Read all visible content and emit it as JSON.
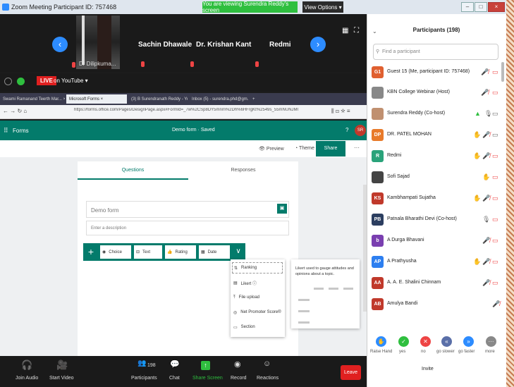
{
  "window": {
    "title": "Zoom Meeting Participant ID: 757468",
    "viewing_banner": "You are viewing Surendra Reddy's screen",
    "view_options": "View Options ▾"
  },
  "strip": {
    "thumb_label": "Dr Dilipkuma...",
    "names": [
      "Sachin Dhawale",
      "Dr. Krishan Kant",
      "Redmi"
    ]
  },
  "live": {
    "badge": "LIVE",
    "platform": "on YouTube ▾"
  },
  "browser": {
    "tabs": [
      "Swami Ramanand Teerth Mar... ×",
      "Microsoft Forms ×",
      "(3) B Surendranath Reddy - Yo... ×",
      "Inbox (5) - surendra.phd@gm... ×",
      "+"
    ],
    "url": "https://forms.office.com/Pages/DesignPage.aspx#FormId=_7w%2CSp8DY5mnm%2Dh%6HFrgKt%2549s_55mNUNJMO"
  },
  "forms": {
    "app_name": "Forms",
    "doc_title": "Demo form · Saved",
    "avatar": "SR",
    "preview": "Preview",
    "theme": "Theme",
    "share": "Share",
    "tab_questions": "Questions",
    "tab_responses": "Responses",
    "title_placeholder": "Demo form",
    "desc_placeholder": "Enter a description",
    "add_types": [
      "Choice",
      "Text",
      "Rating",
      "Date"
    ],
    "more_types": [
      "Ranking",
      "Likert ⓘ",
      "File upload",
      "Net Promoter Score®",
      "Section"
    ],
    "tooltip": "Likert used to gauge attitudes and opinions about a topic."
  },
  "bottom": {
    "join_audio": "Join Audio",
    "start_video": "Start Video",
    "participants_count": "198",
    "participants": "Participants",
    "chat": "Chat",
    "share_screen": "Share Screen",
    "record": "Record",
    "reactions": "Reactions",
    "leave": "Leave"
  },
  "panel": {
    "title": "Participants (198)",
    "search_placeholder": "Find a participant",
    "participants": [
      {
        "initials": "G1",
        "name": "Guest 15 (Me, participant ID: 757468)",
        "color": "#e06030"
      },
      {
        "initials": "",
        "name": "KBN College Webinar (Host)",
        "color": "#888888"
      },
      {
        "initials": "",
        "name": "Surendra Reddy (Co-host)",
        "color": "#c09070"
      },
      {
        "initials": "DP",
        "name": "DR. PATEL MOHAN",
        "color": "#e87a2a"
      },
      {
        "initials": "R",
        "name": "Redmi",
        "color": "#2aa37a"
      },
      {
        "initials": "",
        "name": "Sofi Sajad",
        "color": "#444444"
      },
      {
        "initials": "KS",
        "name": "Kambhampati Sujatha",
        "color": "#c0392b"
      },
      {
        "initials": "PB",
        "name": "Patnala Bharathi Devi (Co-host)",
        "color": "#2c3e60"
      },
      {
        "initials": "b",
        "name": "A Durga Bhavani",
        "color": "#7a3fb0"
      },
      {
        "initials": "AP",
        "name": "A Prathyusha",
        "color": "#2d7ff0"
      },
      {
        "initials": "AA",
        "name": "A. A. E. Shalini Chinnam",
        "color": "#c0392b"
      },
      {
        "initials": "AB",
        "name": "Amulya Bandi",
        "color": "#c0392b"
      }
    ],
    "reactions": [
      "Raise Hand",
      "yes",
      "no",
      "go slower",
      "go faster",
      "more"
    ],
    "invite": "Invite"
  }
}
